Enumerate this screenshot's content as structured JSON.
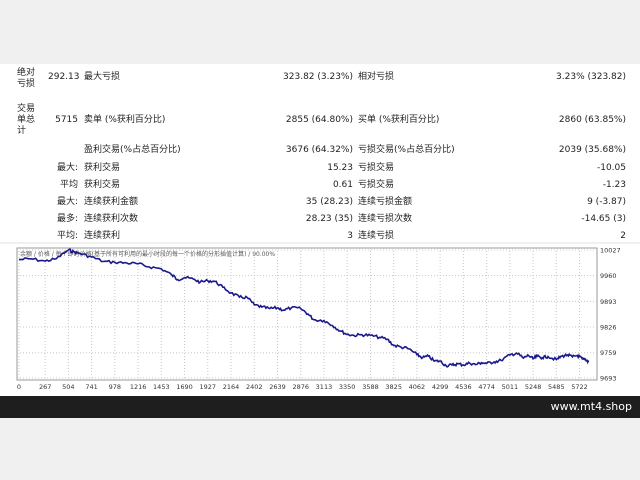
{
  "stats": {
    "abs_loss_label": "绝对\n亏损",
    "abs_loss_value": "292.13",
    "max_loss_label": "最大亏损",
    "max_loss_value": "323.82 (3.23%)",
    "rel_loss_label": "相对亏损",
    "rel_loss_value": "3.23% (323.82)",
    "total_trades_label": "交易\n单总\n计",
    "total_trades_value": "5715",
    "short_label": "卖单 (%获利百分比)",
    "short_value": "2855 (64.80%)",
    "long_label": "买单 (%获利百分比)",
    "long_value": "2860 (63.85%)",
    "profit_trades_label": "盈利交易(%占总百分比)",
    "profit_trades_value": "3676 (64.32%)",
    "loss_trades_label": "亏损交易(%占总百分比)",
    "loss_trades_value": "2039 (35.68%)",
    "rows": [
      {
        "prefix": "最大:",
        "l1": "获利交易",
        "v1": "15.23",
        "l2": "亏损交易",
        "v2": "-10.05"
      },
      {
        "prefix": "平均",
        "l1": "获利交易",
        "v1": "0.61",
        "l2": "亏损交易",
        "v2": "-1.23"
      },
      {
        "prefix": "最大:",
        "l1": "连续获利金额",
        "v1": "35 (28.23)",
        "l2": "连续亏损金额",
        "v2": "9 (-3.87)"
      },
      {
        "prefix": "最多:",
        "l1": "连续获利次数",
        "v1": "28.23 (35)",
        "l2": "连续亏损次数",
        "v2": "-14.65 (3)"
      },
      {
        "prefix": "平均:",
        "l1": "连续获利",
        "v1": "3",
        "l2": "连续亏损",
        "v2": "2"
      }
    ]
  },
  "chart_data": {
    "type": "line",
    "title": "余额 / 价格 / 每个即时价格(基于所有可利用的最小时段的每一个价格的分形插值计算) / 90.00%",
    "x_ticks": [
      "0",
      "267",
      "504",
      "741",
      "978",
      "1216",
      "1453",
      "1690",
      "1927",
      "2164",
      "2402",
      "2639",
      "2876",
      "3113",
      "3350",
      "3588",
      "3825",
      "4062",
      "4299",
      "4536",
      "4774",
      "5011",
      "5248",
      "5485",
      "5722"
    ],
    "y_ticks": [
      "10027",
      "9960",
      "9893",
      "9826",
      "9759",
      "9693"
    ],
    "ylim": [
      9693,
      10027
    ],
    "xlim": [
      0,
      5880
    ],
    "colors": {
      "line": "#1a1a8c",
      "grid": "#c8c8c8"
    },
    "series": [
      {
        "x": [
          0,
          120,
          267,
          380,
          504,
          560,
          620,
          741,
          860,
          978,
          1100,
          1216,
          1330,
          1453,
          1560,
          1620,
          1690,
          1780,
          1850,
          1927,
          2000,
          2080,
          2164,
          2250,
          2330,
          2402,
          2480,
          2560,
          2639,
          2700,
          2780,
          2876,
          2950,
          3010,
          3113,
          3200,
          3280,
          3350,
          3420,
          3500,
          3588,
          3680,
          3760,
          3825,
          3900,
          3980,
          4062,
          4120,
          4180,
          4240,
          4299,
          4360,
          4420,
          4480,
          4536,
          4600,
          4660,
          4720,
          4774,
          4850,
          4920,
          5011,
          5080,
          5150,
          5200,
          5248,
          5290,
          5340,
          5400,
          5485,
          5540,
          5600,
          5650,
          5700,
          5750,
          5790,
          5820
        ],
        "y": [
          10002,
          10004,
          9998,
          10004,
          10027,
          10022,
          10018,
          10009,
          9997,
          9995,
          9993,
          9991,
          9983,
          9978,
          9962,
          9950,
          9955,
          9951,
          9943,
          9947,
          9945,
          9930,
          9915,
          9904,
          9903,
          9884,
          9878,
          9874,
          9876,
          9870,
          9876,
          9874,
          9860,
          9845,
          9843,
          9830,
          9816,
          9807,
          9804,
          9806,
          9804,
          9799,
          9794,
          9778,
          9774,
          9769,
          9754,
          9746,
          9750,
          9737,
          9737,
          9725,
          9727,
          9730,
          9727,
          9732,
          9728,
          9733,
          9731,
          9735,
          9739,
          9753,
          9758,
          9745,
          9752,
          9743,
          9750,
          9746,
          9749,
          9741,
          9750,
          9753,
          9748,
          9752,
          9743,
          9738,
          9736
        ]
      }
    ]
  },
  "footer": {
    "site": "www.mt4.shop"
  }
}
